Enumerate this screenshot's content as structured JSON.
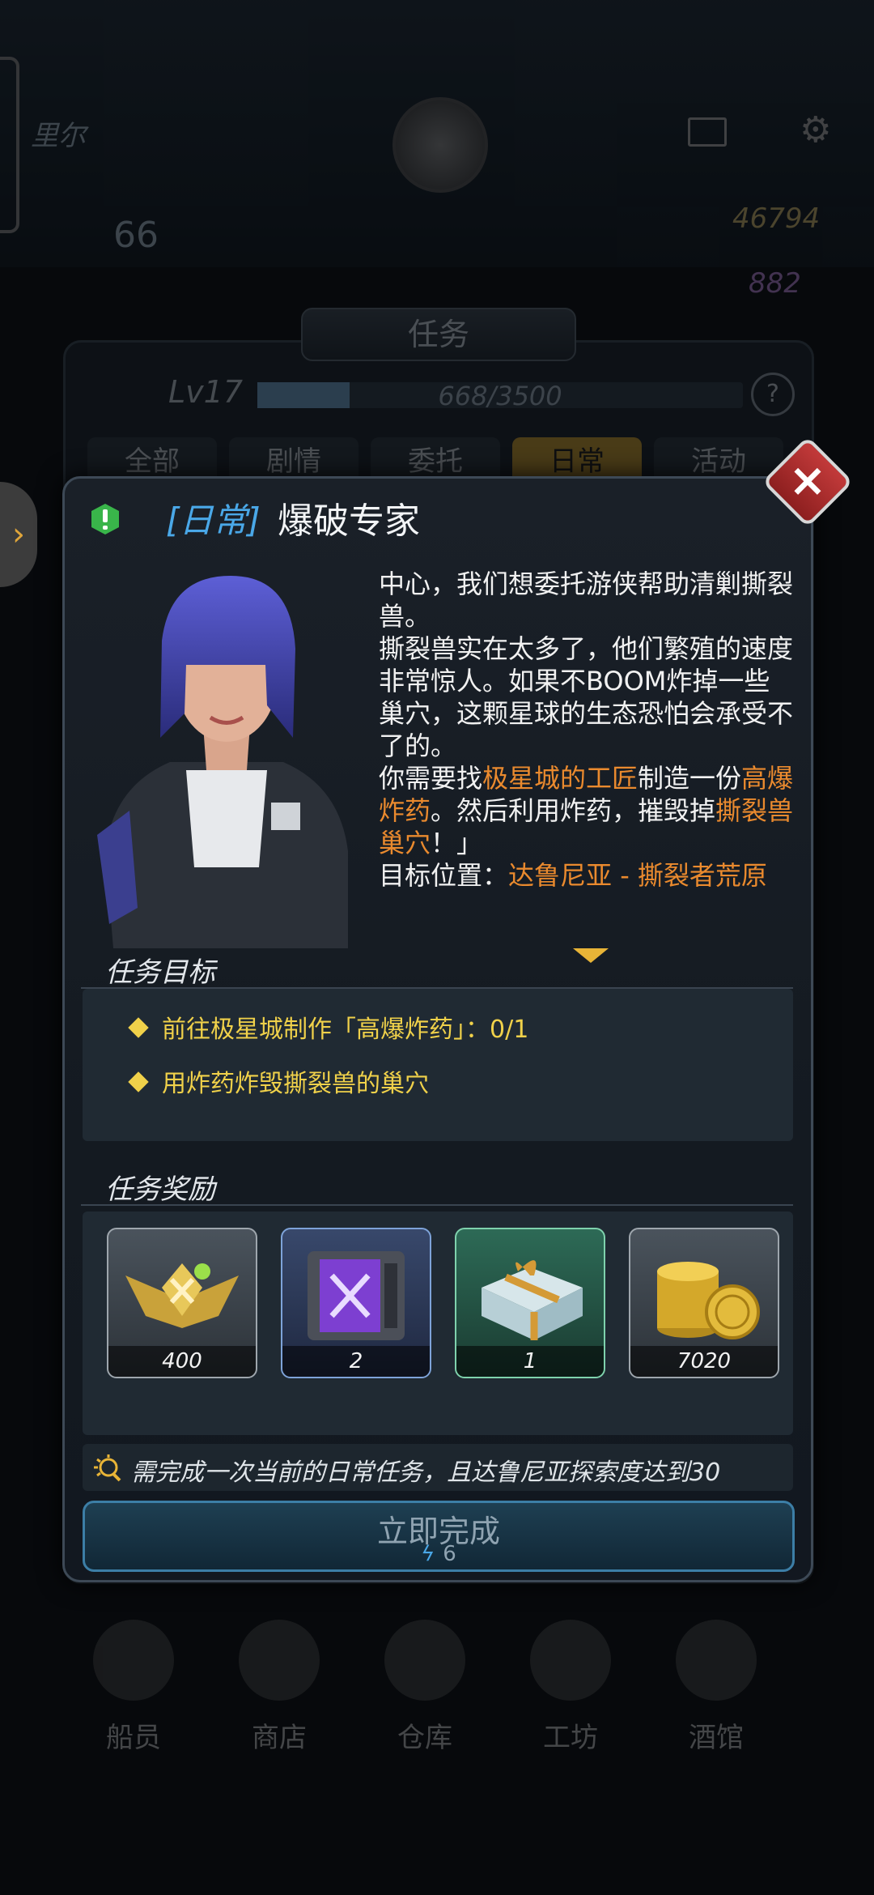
{
  "background": {
    "player_name": "里尔",
    "level": "66",
    "avatar_level": "17",
    "gold": "46794",
    "gems": "882",
    "quest_panel": {
      "title": "任务",
      "level_label": "Lv17",
      "xp_text": "668/3500",
      "xp_fraction": 0.19,
      "help": "?",
      "tabs": [
        "全部",
        "剧情",
        "委托",
        "日常",
        "活动"
      ],
      "active_tab": "日常"
    },
    "bottom_nav": [
      "船员",
      "商店",
      "仓库",
      "工坊",
      "酒馆"
    ]
  },
  "dialog": {
    "category": "[日常]",
    "title": "爆破专家",
    "description": {
      "p1": "中心，我们想委托游侠帮助清剿撕裂兽。",
      "p2": "撕裂兽实在太多了，他们繁殖的速度非常惊人。如果不BOOM炸掉一些巢穴，这颗星球的生态恐怕会承受不了的。",
      "p3_a": "你需要找",
      "p3_hl1": "极星城的工匠",
      "p3_b": "制造一份",
      "p3_hl2": "高爆炸药",
      "p3_c": "。然后利用炸药，摧毁掉",
      "p3_hl3": "撕裂兽巢穴",
      "p3_d": "！」",
      "p4_a": "目标位置：",
      "p4_hl": "达鲁尼亚 - 撕裂者荒原"
    },
    "objectives_title": "任务目标",
    "objectives": [
      "前往极星城制作「高爆炸药」：0/1",
      "用炸药炸毁撕裂兽的巢穴"
    ],
    "rewards_title": "任务奖励",
    "rewards": [
      {
        "icon": "rank-badge-icon",
        "count": "400"
      },
      {
        "icon": "purple-crate-icon",
        "count": "2"
      },
      {
        "icon": "gift-box-icon",
        "count": "1"
      },
      {
        "icon": "gold-coins-icon",
        "count": "7020"
      }
    ],
    "requirement": "需完成一次当前的日常任务，且达鲁尼亚探索度达到30",
    "complete_label": "立即完成",
    "complete_cost": "6"
  },
  "colors": {
    "highlight": "#ea8a2e",
    "category": "#4aa8e8",
    "objective": "#f0d14a",
    "close": "#c23a3a"
  }
}
